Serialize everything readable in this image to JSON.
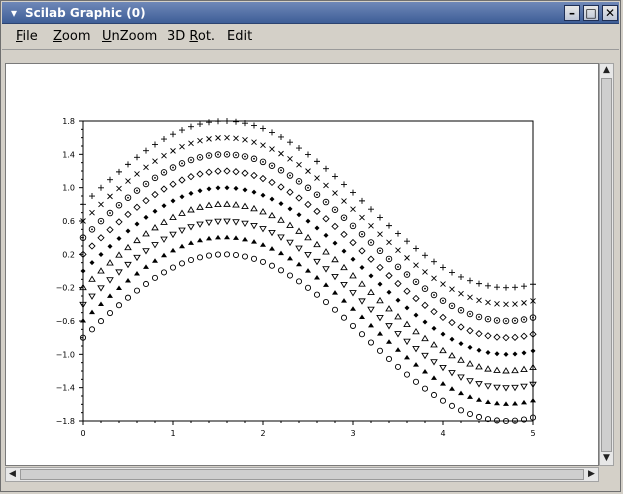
{
  "window": {
    "title": "Scilab Graphic (0)"
  },
  "title_buttons": {
    "menu": "▾",
    "minimize": "–",
    "maximize": "□",
    "close": "✕"
  },
  "menu": {
    "items": [
      {
        "label": "File",
        "mnemonic_index": 0
      },
      {
        "label": "Zoom",
        "mnemonic_index": 0
      },
      {
        "label": "UnZoom",
        "mnemonic_index": 0
      },
      {
        "label": "3D Rot.",
        "mnemonic_index": 3
      },
      {
        "label": "Edit",
        "mnemonic_index": -1
      }
    ]
  },
  "chart_data": {
    "type": "scatter",
    "title": "",
    "xlabel": "",
    "ylabel": "",
    "xlim": [
      0,
      5
    ],
    "ylim": [
      -1.8,
      1.8
    ],
    "x_ticks": [
      "0",
      "1",
      "2",
      "3",
      "4",
      "5"
    ],
    "y_ticks": [
      "1.8",
      "1.4",
      "1.0",
      "0.6",
      "0.2",
      "−0.2",
      "−0.6",
      "−1.0",
      "−1.4",
      "−1.8"
    ],
    "x_range": [
      0,
      5
    ],
    "points_per_series": 51,
    "formula": "y = sin(x) + offset",
    "grid": false,
    "series": [
      {
        "marker": "circle",
        "offset": -0.8
      },
      {
        "marker": "club",
        "offset": -0.6
      },
      {
        "marker": "triangle-down",
        "offset": -0.4
      },
      {
        "marker": "triangle-up",
        "offset": -0.2
      },
      {
        "marker": "diamond-filled",
        "offset": 0.0
      },
      {
        "marker": "diamond",
        "offset": 0.2
      },
      {
        "marker": "circle-dot",
        "offset": 0.4
      },
      {
        "marker": "cross",
        "offset": 0.6
      },
      {
        "marker": "plus",
        "offset": 0.8
      }
    ]
  },
  "scrollbars": {
    "up": "▲",
    "down": "▼",
    "left": "◀",
    "right": "▶"
  }
}
